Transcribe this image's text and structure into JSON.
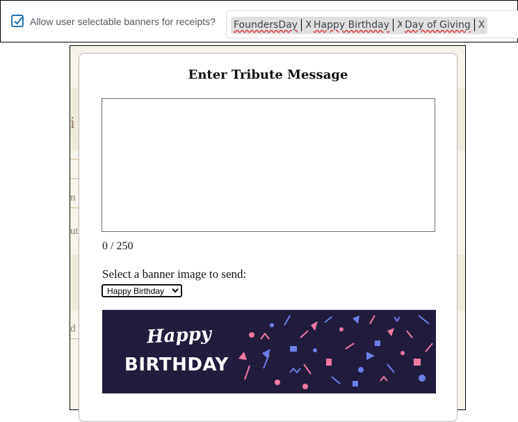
{
  "settings": {
    "allow_banners_label": "Allow user selectable banners for receipts?",
    "allow_banners_checked": true,
    "tags": [
      {
        "label": "FoundersDay",
        "remove": "X"
      },
      {
        "label": "Happy Birthday",
        "remove": "X"
      },
      {
        "label": "Day of Giving",
        "remove": "X"
      }
    ]
  },
  "modal": {
    "title": "Enter Tribute Message",
    "message_value": "",
    "char_count": "0 / 250",
    "banner_label": "Select a banner image to send:",
    "banner_selected": "Happy Birthday",
    "banner_options": [
      "Happy Birthday"
    ],
    "banner_image": {
      "line1": "Happy",
      "line2": "BIRTHDAY"
    }
  },
  "background": {
    "fragments": [
      "i",
      "n",
      "ut",
      "d"
    ]
  },
  "colors": {
    "accent": "#2271b1",
    "tag_bg": "#e0e0e0",
    "banner_bg": "#211c3c",
    "confetti_pink": "#f07aa0",
    "confetti_blue": "#6d7fe8"
  }
}
